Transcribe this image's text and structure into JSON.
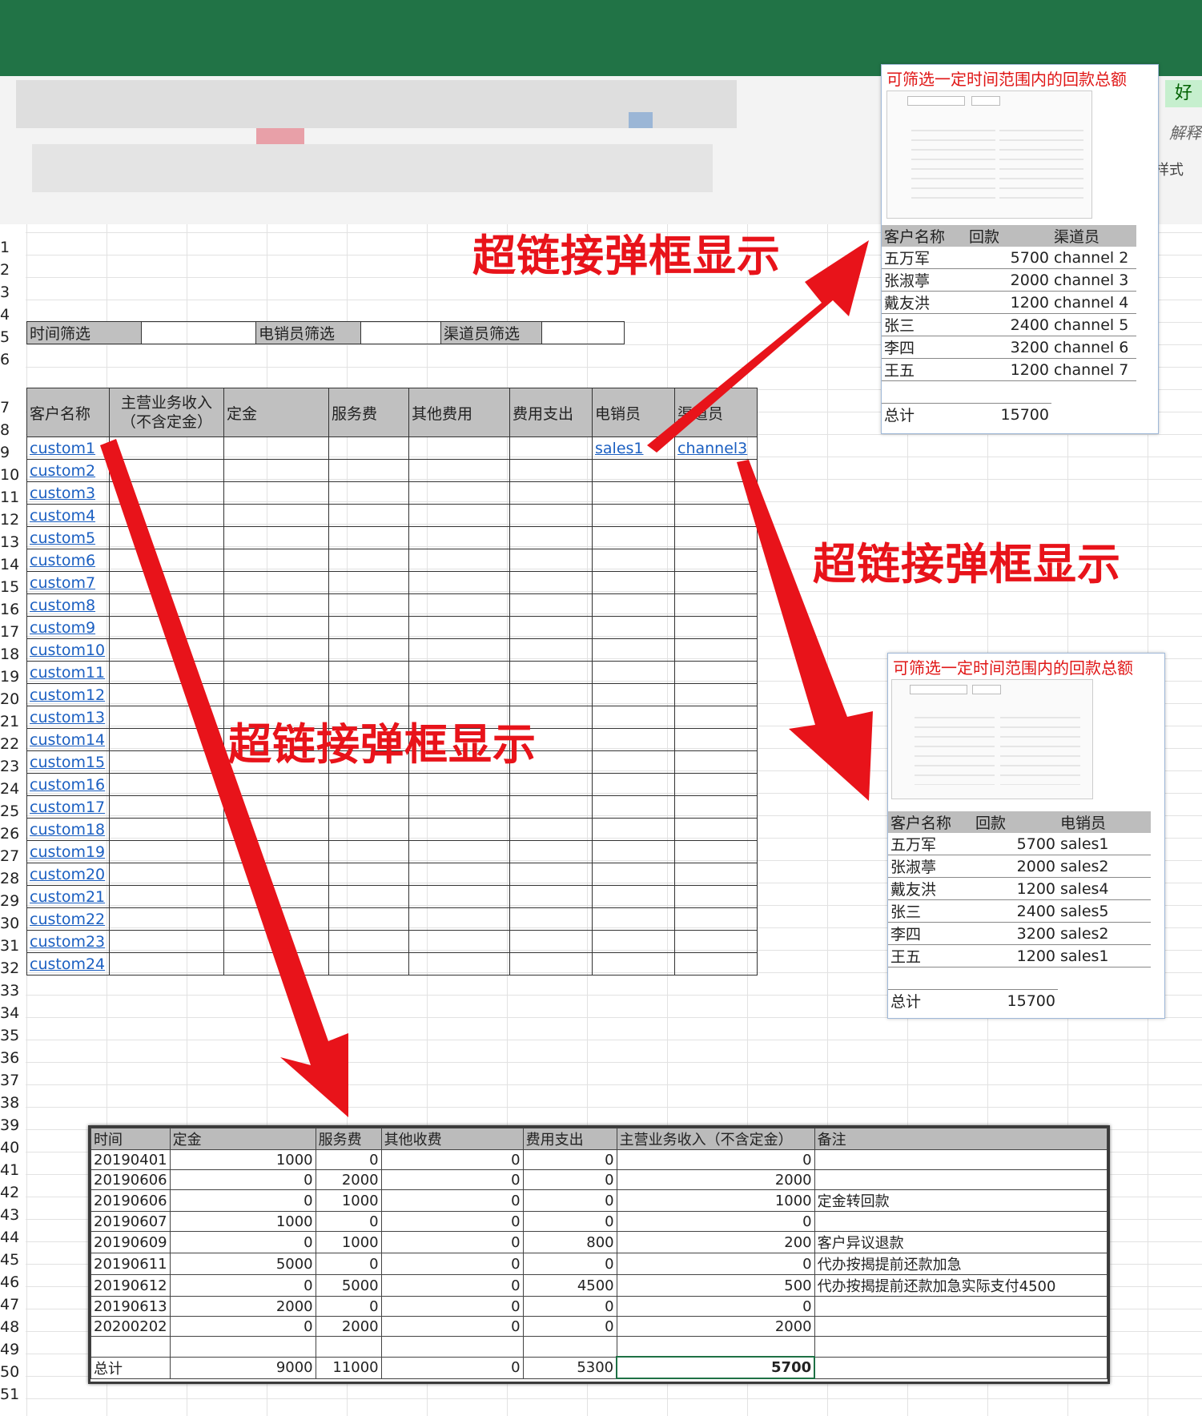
{
  "ribbon": {
    "style_label": "样式",
    "good_label": "好",
    "explain_label": "解释"
  },
  "row_numbers": [
    "1",
    "2",
    "3",
    "4",
    "5",
    "6",
    "7",
    "8",
    "9",
    "10",
    "11",
    "12",
    "13",
    "14",
    "15",
    "16",
    "17",
    "18",
    "19",
    "20",
    "21",
    "22",
    "23",
    "24",
    "25",
    "26",
    "27",
    "28",
    "29",
    "30",
    "31",
    "32",
    "33",
    "34",
    "35",
    "36",
    "37",
    "38",
    "39",
    "40",
    "41",
    "42",
    "43",
    "44",
    "45",
    "46",
    "47",
    "48",
    "49",
    "50",
    "51"
  ],
  "filters": {
    "time": "时间筛选",
    "sales": "电销员筛选",
    "channel": "渠道员筛选"
  },
  "main_table": {
    "headers": [
      "客户名称",
      "主营业务收入（不含定金）",
      "定金",
      "服务费",
      "其他费用",
      "费用支出",
      "电销员",
      "渠道员"
    ],
    "header_income_line1": "主营业务收入",
    "header_income_line2": "（不含定金）",
    "customers": [
      "custom1",
      "custom2",
      "custom3",
      "custom4",
      "custom5",
      "custom6",
      "custom7",
      "custom8",
      "custom9",
      "custom10",
      "custom11",
      "custom12",
      "custom13",
      "custom14",
      "custom15",
      "custom16",
      "custom17",
      "custom18",
      "custom19",
      "custom20",
      "custom21",
      "custom22",
      "custom23",
      "custom24"
    ],
    "first_sales": "sales1",
    "first_channel": "channel3"
  },
  "callouts": {
    "text": "超链接弹框显示"
  },
  "popup_top": {
    "title": "可筛选一定时间范围内的回款总额",
    "headers": [
      "客户名称",
      "回款",
      "渠道员"
    ],
    "rows": [
      [
        "五万军",
        "5700",
        "channel 2"
      ],
      [
        "张淑葶",
        "2000",
        "channel 3"
      ],
      [
        "戴友洪",
        "1200",
        "channel 4"
      ],
      [
        "张三",
        "2400",
        "channel 5"
      ],
      [
        "李四",
        "3200",
        "channel 6"
      ],
      [
        "王五",
        "1200",
        "channel 7"
      ]
    ],
    "total_label": "总计",
    "total_value": "15700"
  },
  "popup_bottom": {
    "title": "可筛选一定时间范围内的回款总额",
    "headers": [
      "客户名称",
      "回款",
      "电销员"
    ],
    "rows": [
      [
        "五万军",
        "5700",
        "sales1"
      ],
      [
        "张淑葶",
        "2000",
        "sales2"
      ],
      [
        "戴友洪",
        "1200",
        "sales4"
      ],
      [
        "张三",
        "2400",
        "sales5"
      ],
      [
        "李四",
        "3200",
        "sales2"
      ],
      [
        "王五",
        "1200",
        "sales1"
      ]
    ],
    "total_label": "总计",
    "total_value": "15700"
  },
  "detail_table": {
    "headers": [
      "时间",
      "定金",
      "服务费",
      "其他收费",
      "费用支出",
      "主营业务收入（不含定金）",
      "备注"
    ],
    "rows": [
      [
        "20190401",
        "1000",
        "0",
        "0",
        "0",
        "0",
        ""
      ],
      [
        "20190606",
        "0",
        "2000",
        "0",
        "0",
        "2000",
        ""
      ],
      [
        "20190606",
        "0",
        "1000",
        "0",
        "0",
        "1000",
        "定金转回款"
      ],
      [
        "20190607",
        "1000",
        "0",
        "0",
        "0",
        "0",
        ""
      ],
      [
        "20190609",
        "0",
        "1000",
        "0",
        "800",
        "200",
        "客户异议退款"
      ],
      [
        "20190611",
        "5000",
        "0",
        "0",
        "0",
        "0",
        "代办按揭提前还款加急"
      ],
      [
        "20190612",
        "0",
        "5000",
        "0",
        "4500",
        "500",
        "代办按揭提前还款加急实际支付4500"
      ],
      [
        "20190613",
        "2000",
        "0",
        "0",
        "0",
        "0",
        ""
      ],
      [
        "20200202",
        "0",
        "2000",
        "0",
        "0",
        "2000",
        ""
      ]
    ],
    "total": [
      "总计",
      "9000",
      "11000",
      "0",
      "5300",
      "5700",
      ""
    ]
  },
  "colors": {
    "ribbon_green": "#217346",
    "callout_red": "#e8131a",
    "link_blue": "#1b5fc1",
    "header_gray": "#c0c0c0"
  }
}
